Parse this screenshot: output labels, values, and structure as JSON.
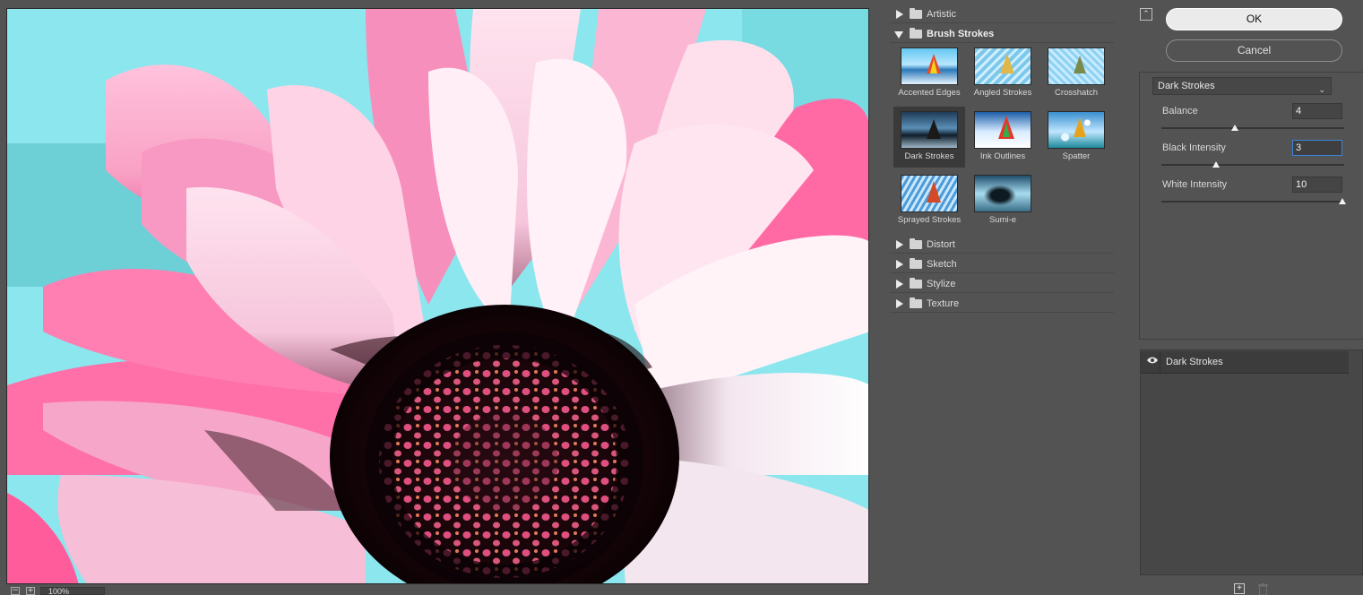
{
  "zoom": {
    "value": "100%",
    "minus": "−",
    "plus": "+"
  },
  "gallery": {
    "categories": [
      {
        "label": "Artistic",
        "open": false
      },
      {
        "label": "Brush Strokes",
        "open": true
      },
      {
        "label": "Distort",
        "open": false
      },
      {
        "label": "Sketch",
        "open": false
      },
      {
        "label": "Stylize",
        "open": false
      },
      {
        "label": "Texture",
        "open": false
      }
    ],
    "brush_strokes": [
      {
        "label": "Accented Edges"
      },
      {
        "label": "Angled Strokes"
      },
      {
        "label": "Crosshatch"
      },
      {
        "label": "Dark Strokes",
        "selected": true
      },
      {
        "label": "Ink Outlines"
      },
      {
        "label": "Spatter"
      },
      {
        "label": "Sprayed Strokes"
      },
      {
        "label": "Sumi-e"
      }
    ]
  },
  "buttons": {
    "ok": "OK",
    "cancel": "Cancel"
  },
  "filter_select": {
    "value": "Dark Strokes"
  },
  "params": [
    {
      "label": "Balance",
      "value": "4",
      "level_fraction": 0.4
    },
    {
      "label": "Black Intensity",
      "value": "3",
      "level_fraction": 0.3,
      "focused": true
    },
    {
      "label": "White Intensity",
      "value": "10",
      "level_fraction": 1.0
    }
  ],
  "layers": [
    {
      "label": "Dark Strokes",
      "visible": true
    }
  ],
  "colors": {
    "panel_bg": "#535353",
    "accent_focus": "#3b84d6",
    "ok_bg": "#ebebeb"
  },
  "icons": {
    "collapse": "double-chevron-up-icon",
    "eye": "eye-icon",
    "new_layer": "new-effect-layer-icon",
    "trash": "trash-icon",
    "folder": "folder-icon"
  }
}
